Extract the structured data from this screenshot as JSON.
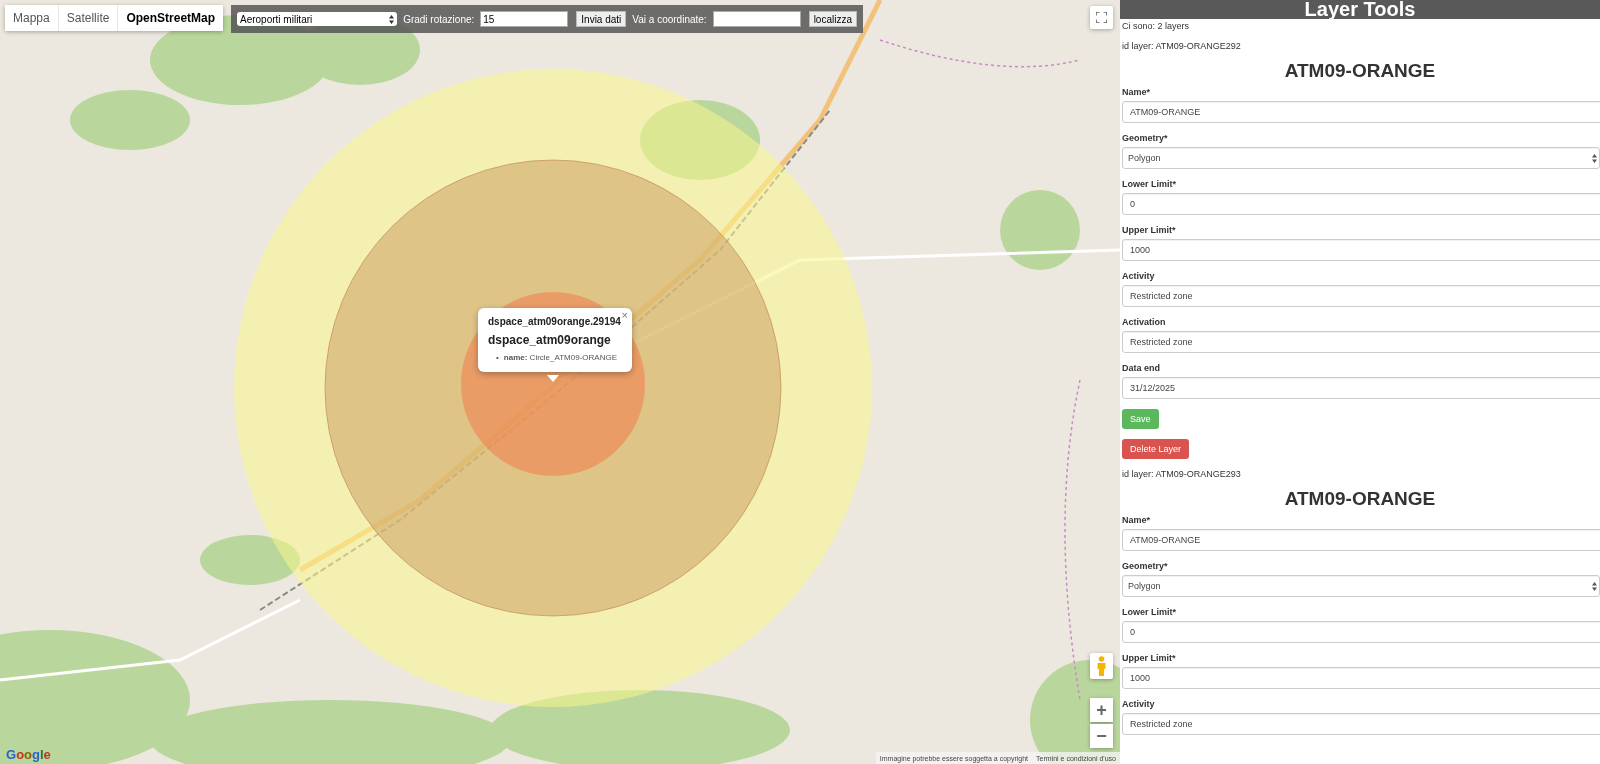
{
  "map_type_tabs": [
    {
      "label": "Mappa",
      "selected": false
    },
    {
      "label": "Satellite",
      "selected": false
    },
    {
      "label": "OpenStreetMap",
      "selected": true
    }
  ],
  "toolbar": {
    "layer_select": "Aeroporti militari",
    "rotation_label": "Gradi rotazione:",
    "rotation_value": "15",
    "send_button": "Invia dati",
    "coords_label": "Vai a coordinate:",
    "locate_button": "localizza"
  },
  "map": {
    "popup": {
      "close": "×",
      "title": "dspace_atm09orange.29194",
      "subtitle": "dspace_atm09orange",
      "properties": [
        {
          "bullet": "•",
          "key": "name:",
          "value": "Circle_ATM09-ORANGE"
        }
      ]
    },
    "zoom_in": "+",
    "zoom_out": "−",
    "attribution": {
      "logo": "Google",
      "notice": "Immagine potrebbe essere soggetta a copyright",
      "terms": "Termini e condizioni d'uso"
    }
  },
  "panel": {
    "title": "Layer Tools",
    "count": "Ci sono: 2 layers",
    "layers": [
      {
        "id": "id layer: ATM09-ORANGE292",
        "heading": "ATM09-ORANGE",
        "fields": [
          {
            "label": "Name*",
            "value": "ATM09-ORANGE",
            "kind": "text"
          },
          {
            "label": "Geometry*",
            "value": "Polygon",
            "kind": "select"
          },
          {
            "label": "Lower Limit*",
            "value": "0",
            "kind": "text"
          },
          {
            "label": "Upper Limit*",
            "value": "1000",
            "kind": "text"
          },
          {
            "label": "Activity",
            "value": "Restricted zone",
            "kind": "text"
          },
          {
            "label": "Activation",
            "value": "Restricted zone",
            "kind": "text"
          },
          {
            "label": "Data end",
            "value": "31/12/2025",
            "kind": "text"
          }
        ],
        "buttons": [
          {
            "label": "Save",
            "kind": "save"
          },
          {
            "label": "Delete Layer",
            "kind": "delete"
          }
        ]
      },
      {
        "id": "id layer: ATM09-ORANGE293",
        "heading": "ATM09-ORANGE",
        "fields": [
          {
            "label": "Name*",
            "value": "ATM09-ORANGE",
            "kind": "text"
          },
          {
            "label": "Geometry*",
            "value": "Polygon",
            "kind": "select"
          },
          {
            "label": "Lower Limit*",
            "value": "0",
            "kind": "text"
          },
          {
            "label": "Upper Limit*",
            "value": "1000",
            "kind": "text"
          },
          {
            "label": "Activity",
            "value": "Restricted zone",
            "kind": "text"
          }
        ]
      }
    ]
  }
}
